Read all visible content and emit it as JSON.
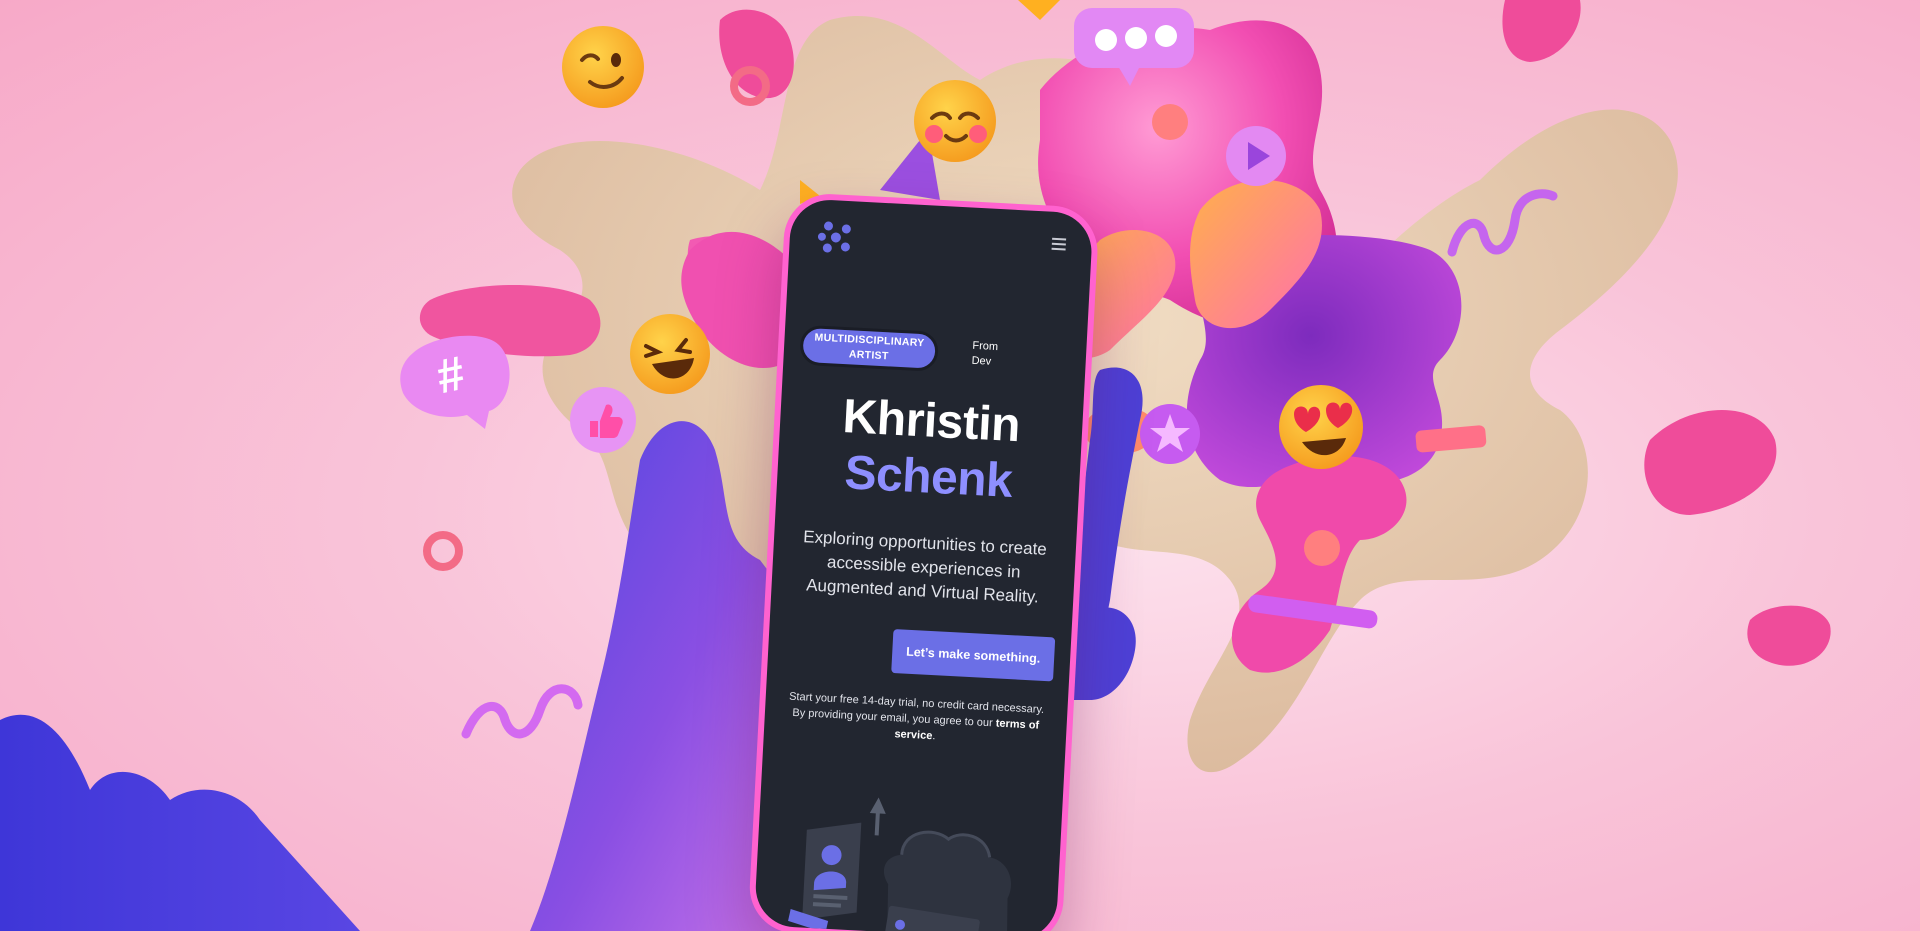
{
  "phone": {
    "tabs": [
      {
        "label_line1": "MULTIDISCIPLINARY",
        "label_line2": "ARTIST"
      },
      {
        "label_line1": "From",
        "label_line2": "Dev"
      }
    ],
    "hero": {
      "first_name": "Khristin",
      "last_name": "Schenk",
      "tagline_line1": "Exploring opportunities to create",
      "tagline_line2": "accessible experiences in",
      "tagline_line3": "Augmented and Virtual Reality.",
      "cta_label": "Let’s make something."
    },
    "fine_print": {
      "line1": "Start your free 14-day trial, no credit card necessary.",
      "line2_prefix": "By providing your email, you agree to our",
      "link_word1": "terms of",
      "link_word2": "service",
      "suffix": "."
    }
  },
  "decorations": {
    "speech_bubble_symbol": "#",
    "icons": [
      "wink-emoji-icon",
      "blush-emoji-icon",
      "laughing-emoji-icon",
      "heart-eyes-emoji-icon",
      "thumbs-up-icon",
      "play-icon",
      "star-icon",
      "chat-bubble-icon",
      "hashtag-bubble-icon",
      "hamburger-menu-icon",
      "dots-logo-icon"
    ]
  },
  "colors": {
    "background": "#f9c4d9",
    "phone_frame": "#ff62cf",
    "screen": "#222630",
    "accent": "#6b6fe6",
    "last_name": "#8e8fff",
    "hand": "#6a4de0"
  }
}
